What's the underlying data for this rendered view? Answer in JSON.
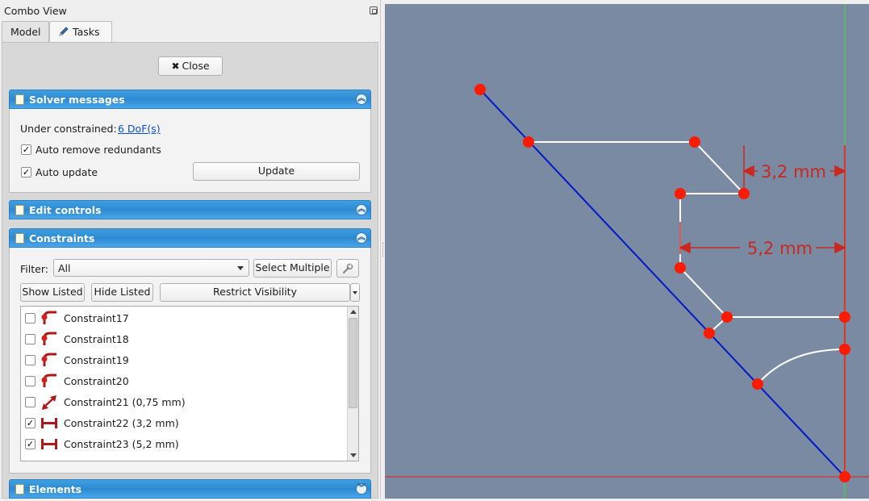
{
  "panel": {
    "title": "Combo View",
    "tabs": [
      {
        "label": "Model"
      },
      {
        "label": "Tasks"
      }
    ],
    "close_label": "Close"
  },
  "solver": {
    "header": "Solver messages",
    "under_constrained_label": "Under constrained:",
    "dof_link": "6 DoF(s)",
    "auto_remove_label": "Auto remove redundants",
    "auto_remove_checked": true,
    "auto_update_label": "Auto update",
    "auto_update_checked": true,
    "update_label": "Update"
  },
  "edit_controls": {
    "header": "Edit controls"
  },
  "constraints": {
    "header": "Constraints",
    "filter_label": "Filter:",
    "filter_value": "All",
    "select_multiple_label": "Select Multiple",
    "show_listed_label": "Show Listed",
    "hide_listed_label": "Hide Listed",
    "restrict_visibility_label": "Restrict Visibility",
    "items": [
      {
        "label": "Constraint17",
        "checked": false,
        "icon": "tangent-icon"
      },
      {
        "label": "Constraint18",
        "checked": false,
        "icon": "tangent-icon"
      },
      {
        "label": "Constraint19",
        "checked": false,
        "icon": "tangent-icon"
      },
      {
        "label": "Constraint20",
        "checked": false,
        "icon": "tangent-icon"
      },
      {
        "label": "Constraint21 (0,75 mm)",
        "checked": false,
        "icon": "distance-icon"
      },
      {
        "label": "Constraint22 (3,2 mm)",
        "checked": true,
        "icon": "horizontal-distance-icon"
      },
      {
        "label": "Constraint23 (5,2 mm)",
        "checked": true,
        "icon": "horizontal-distance-icon"
      }
    ]
  },
  "elements": {
    "header": "Elements"
  },
  "sketch": {
    "dim1_label": "3,2 mm",
    "dim2_label": "5,2 mm",
    "colors": {
      "background": "#7a8aa3",
      "construction_line": "#0000cc",
      "geometry": "#ffffff",
      "point": "#ff1a00",
      "dimension": "#c8281e",
      "axis_red": "#e02020",
      "axis_green": "#44dd44"
    }
  }
}
